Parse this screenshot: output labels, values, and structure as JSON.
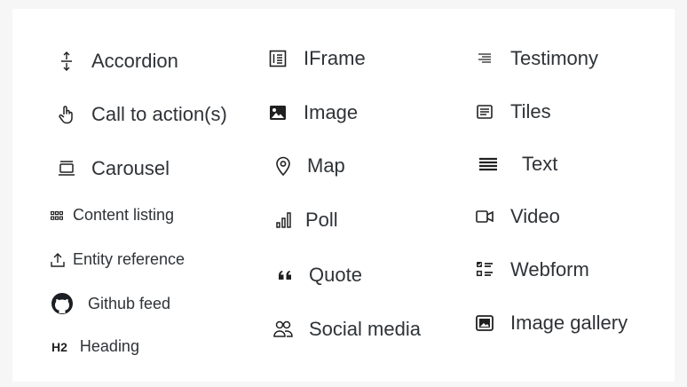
{
  "blocks": {
    "accordion": "Accordion",
    "call_to_action": "Call to action(s)",
    "carousel": "Carousel",
    "content_listing": "Content listing",
    "entity_reference": "Entity reference",
    "github_feed": "Github feed",
    "heading": "Heading",
    "heading_icon_text": "H2",
    "iframe": "IFrame",
    "image": "Image",
    "map": "Map",
    "poll": "Poll",
    "quote": "Quote",
    "social_media": "Social media",
    "testimony": "Testimony",
    "tiles": "Tiles",
    "text": "Text",
    "video": "Video",
    "webform": "Webform",
    "image_gallery": "Image gallery"
  },
  "icons": {
    "accordion": "expand-vertical-icon",
    "call_to_action": "hand-pointer-icon",
    "carousel": "carousel-icon",
    "content_listing": "grid-icon",
    "entity_reference": "upload-icon",
    "github_feed": "github-icon",
    "heading": "h2-icon",
    "iframe": "iframe-icon",
    "image": "image-icon",
    "map": "map-pin-icon",
    "poll": "bar-chart-icon",
    "quote": "quote-icon",
    "social_media": "people-icon",
    "testimony": "testimony-icon",
    "tiles": "tiles-icon",
    "text": "text-lines-icon",
    "video": "video-icon",
    "webform": "checklist-icon",
    "image_gallery": "image-gallery-icon"
  },
  "colors": {
    "text": "#2f3337",
    "icon": "#202020",
    "background": "#ffffff"
  }
}
